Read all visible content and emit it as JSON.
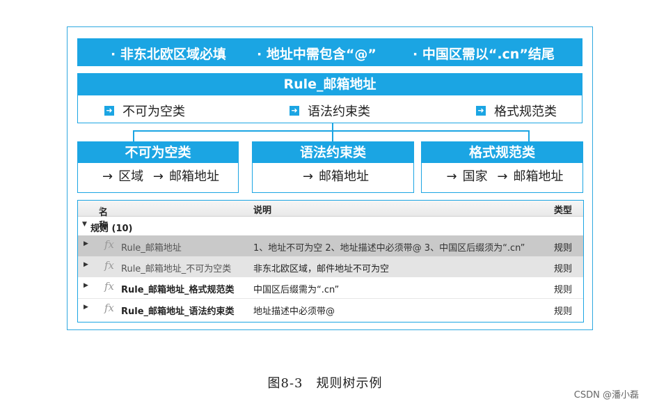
{
  "requirements": [
    "· 非东北欧区域必填",
    "· 地址中需包含“@”",
    "· 中国区需以“.cn”结尾"
  ],
  "rule": {
    "title": "Rule_邮箱地址",
    "categories": [
      "不可为空类",
      "语法约束类",
      "格式规范类"
    ]
  },
  "subrules": [
    {
      "title": "不可为空类",
      "items": [
        "区域",
        "邮箱地址"
      ]
    },
    {
      "title": "语法约束类",
      "items": [
        "邮箱地址"
      ]
    },
    {
      "title": "格式规范类",
      "items": [
        "国家",
        "邮箱地址"
      ]
    }
  ],
  "table": {
    "headers": {
      "name": "名称",
      "desc": "说明",
      "type": "类型"
    },
    "group": "规则 (10)",
    "rows": [
      {
        "name": "Rule_邮箱地址",
        "desc": "1、地址不可为空 2、地址描述中必须带@ 3、中国区后缀须为“.cn”",
        "type": "规则"
      },
      {
        "name": "Rule_邮箱地址_不可为空类",
        "desc": "非东北欧区域，邮件地址不可为空",
        "type": "规则"
      },
      {
        "name": "Rule_邮箱地址_格式规范类",
        "desc": "中国区后缀需为“.cn”",
        "type": "规则"
      },
      {
        "name": "Rule_邮箱地址_语法约束类",
        "desc": "地址描述中必须带@",
        "type": "规则"
      }
    ]
  },
  "caption": "图8-3　规则树示例",
  "watermark": "CSDN @潘小磊",
  "colors": {
    "accent": "#1ba5e3"
  }
}
